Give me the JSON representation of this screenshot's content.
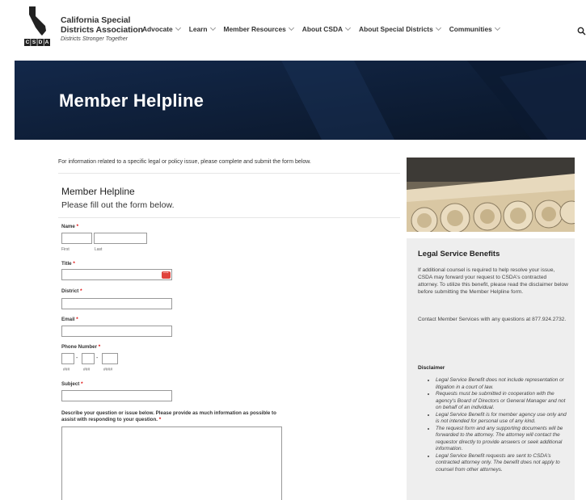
{
  "header": {
    "logo_line1": "California Special",
    "logo_line2": "Districts Association",
    "logo_tagline": "Districts Stronger Together",
    "logo_letters": "CSDA",
    "nav": [
      {
        "label": "Advocate",
        "has_menu": true
      },
      {
        "label": "Learn",
        "has_menu": true
      },
      {
        "label": "Member Resources",
        "has_menu": true
      },
      {
        "label": "About CSDA",
        "has_menu": true
      },
      {
        "label": "About Special Districts",
        "has_menu": true
      },
      {
        "label": "Communities",
        "has_menu": true
      }
    ],
    "search_icon": "search-icon"
  },
  "hero": {
    "title": "Member Helpline",
    "bg_color": "#0f1e36"
  },
  "intro_text": "For information related to a specific legal or policy issue, please complete and submit the form below.",
  "form": {
    "title": "Member Helpline",
    "subtitle": "Please fill out the form below.",
    "required_mark": "*",
    "name_label": "Name",
    "first_label": "First",
    "last_label": "Last",
    "title_label": "Title",
    "district_label": "District",
    "email_label": "Email",
    "phone_label": "Phone Number",
    "phone_hint_1": "###",
    "phone_hint_2": "###",
    "phone_hint_3": "####",
    "phone_sep": "-",
    "subject_label": "Subject",
    "description_label": "Describe your question or issue below. Please provide as much information as possible to assist with responding to your question.",
    "autofill_icon": "dots-icon"
  },
  "sidebar": {
    "title": "Legal Service Benefits",
    "para1": "If additional counsel is required to help resolve your issue, CSDA may forward your request to CSDA's contracted attorney. To utilize this benefit, please read the disclaimer below before submitting the Member Helpline form.",
    "para2": "Contact Member Services with any questions at 877.924.2732.",
    "disclaimer_heading": "Disclaimer",
    "disclaimer_items": [
      "Legal Service Benefit does not include representation or litigation in a court of law.",
      "Requests must be submitted in cooperation with the agency's Board of Directors or General Manager and not on behalf of an individual.",
      "Legal Service Benefit is for member agency use only and is not intended for personal use of any kind.",
      "The request form and any supporting documents will be forwarded to the attorney. The attorney will contact the requestor directly to provide answers or seek additional information.",
      "Legal Service Benefit requests are sent to CSDA's contracted attorney only. The benefit does not apply to counsel from other attorneys."
    ]
  },
  "colors": {
    "accent": "#d00000",
    "hero": "#0f1e36",
    "panel": "#eeeeee"
  }
}
